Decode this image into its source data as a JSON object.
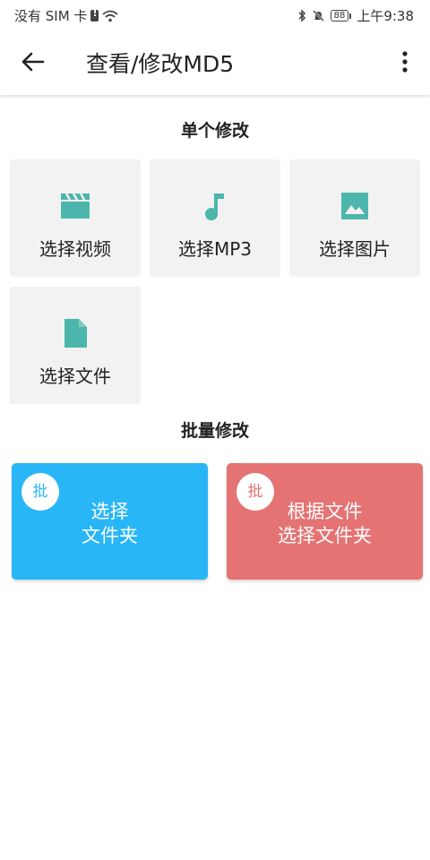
{
  "status_bar": {
    "carrier": "没有 SIM 卡",
    "battery": "88",
    "time": "上午9:38"
  },
  "app_bar": {
    "title": "查看/修改MD5",
    "back_icon": "arrow-back-icon",
    "more_icon": "more-vert-icon"
  },
  "single": {
    "heading": "单个修改",
    "items": [
      {
        "label": "选择视频",
        "icon": "video-clapper-icon"
      },
      {
        "label": "选择MP3",
        "icon": "music-note-icon"
      },
      {
        "label": "选择图片",
        "icon": "image-icon"
      },
      {
        "label": "选择文件",
        "icon": "file-icon"
      }
    ]
  },
  "batch": {
    "heading": "批量修改",
    "cards": [
      {
        "badge": "批",
        "line1": "选择",
        "line2": "文件夹",
        "color": "#29b6f6"
      },
      {
        "badge": "批",
        "line1": "根据文件",
        "line2": "选择文件夹",
        "color": "#e57373"
      }
    ]
  },
  "colors": {
    "icon_teal": "#4db6ac",
    "tile_bg": "#f2f2f2"
  }
}
